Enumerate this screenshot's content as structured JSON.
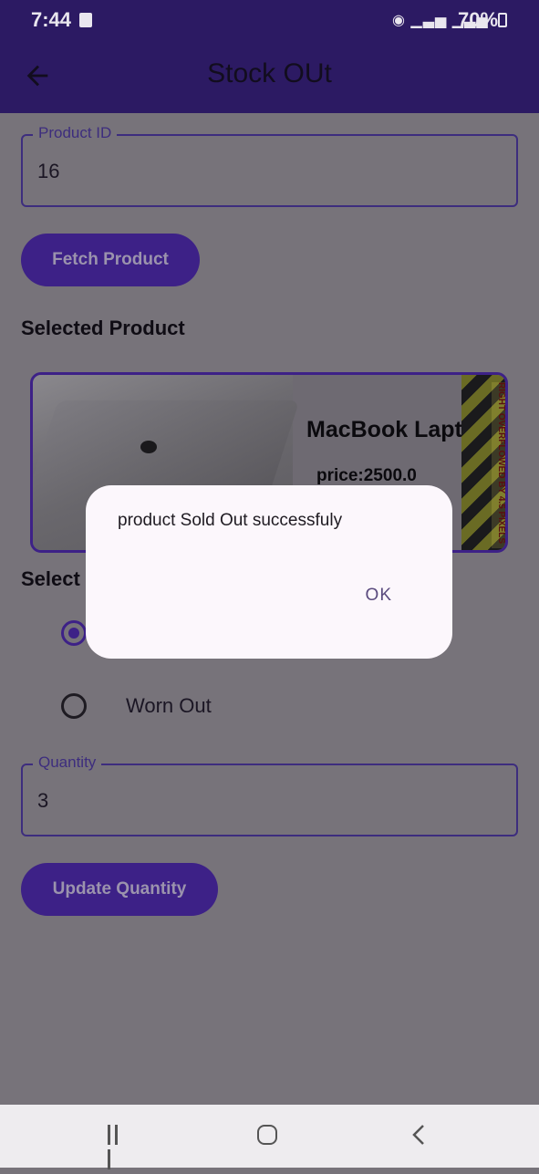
{
  "status_bar": {
    "time": "7:44",
    "battery": "70%"
  },
  "app_bar": {
    "title": "Stock OUt"
  },
  "product_id_field": {
    "label": "Product ID",
    "value": "16"
  },
  "fetch_button": {
    "label": "Fetch Product"
  },
  "selected_product": {
    "heading": "Selected Product",
    "name": "MacBook Laptop",
    "price": "price:2500.0",
    "overflow_warning": "RIGHT OVERFLOWED BY 4.5 PIXELS"
  },
  "reason_section": {
    "heading_visible": "Select",
    "options": [
      {
        "label": "",
        "checked": true
      },
      {
        "label": "Worn Out",
        "checked": false
      }
    ]
  },
  "quantity_field": {
    "label": "Quantity",
    "value": "3"
  },
  "update_button": {
    "label": "Update Quantity"
  },
  "dialog": {
    "message": "product Sold Out successfuly",
    "ok_label": "OK"
  },
  "colors": {
    "primary": "#3d2187",
    "app_bar": "#2c1a63",
    "scrim_background": "#77737a",
    "dialog_background": "#fcf7fc"
  }
}
